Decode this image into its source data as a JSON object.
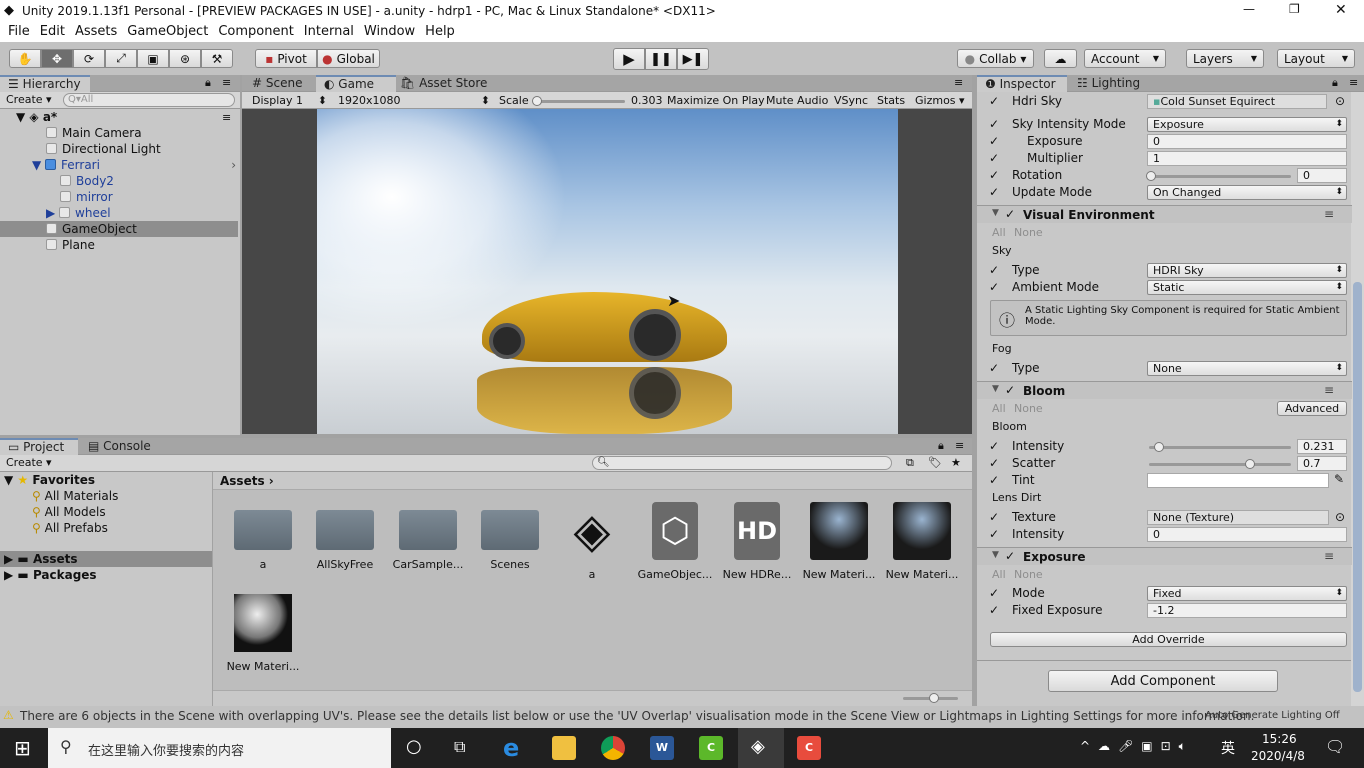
{
  "window": {
    "title": "Unity 2019.1.13f1 Personal - [PREVIEW PACKAGES IN USE] - a.unity - hdrp1 - PC, Mac & Linux Standalone* <DX11>",
    "minimize": "—",
    "maximize": "❐",
    "close": "✕"
  },
  "menu": [
    "File",
    "Edit",
    "Assets",
    "GameObject",
    "Component",
    "Internal",
    "Window",
    "Help"
  ],
  "toolbar": {
    "tools": [
      "hand-icon",
      "move-icon",
      "rotate-icon",
      "scale-icon",
      "rect-icon",
      "transform-icon",
      "custom-tool-icon"
    ],
    "pivot": "Pivot",
    "global": "Global",
    "collab": "Collab ▾",
    "account": "Account",
    "layers": "Layers",
    "layout": "Layout"
  },
  "hierarchy": {
    "tab": "Hierarchy",
    "create": "Create",
    "search_placeholder": "All",
    "scene": "a*",
    "items": [
      {
        "label": "Main Camera"
      },
      {
        "label": "Directional Light"
      },
      {
        "label": "Ferrari"
      },
      {
        "label": "Body2"
      },
      {
        "label": "mirror"
      },
      {
        "label": "wheel"
      },
      {
        "label": "GameObject"
      },
      {
        "label": "Plane"
      }
    ]
  },
  "scene": {
    "tabs": [
      "Scene",
      "Game",
      "Asset Store"
    ],
    "display": "Display 1",
    "resolution": "1920x1080",
    "scale_label": "Scale",
    "scale_value": "0.303",
    "maximize": "Maximize On Play",
    "mute": "Mute Audio",
    "vsync": "VSync",
    "stats": "Stats",
    "gizmos": "Gizmos"
  },
  "project": {
    "tabs": [
      "Project",
      "Console"
    ],
    "create": "Create",
    "favorites": "Favorites",
    "fav_items": [
      "All Materials",
      "All Models",
      "All Prefabs"
    ],
    "roots": [
      "Assets",
      "Packages"
    ],
    "breadcrumb": "Assets",
    "assets": [
      "a",
      "AllSkyFree",
      "CarSample...",
      "Scenes",
      "a",
      "GameObjec...",
      "New HDRe...",
      "New Materi...",
      "New Materi...",
      "New Materi..."
    ],
    "hd": "HD"
  },
  "inspector": {
    "tabs": [
      "Inspector",
      "Lighting"
    ],
    "hdri_sky": "Hdri Sky",
    "hdri_value": "Cold Sunset Equirect",
    "sky_intensity_mode": "Sky Intensity Mode",
    "sky_intensity_value": "Exposure",
    "exposure": "Exposure",
    "exposure_value": "0",
    "multiplier": "Multiplier",
    "multiplier_value": "1",
    "rotation": "Rotation",
    "rotation_value": "0",
    "update_mode": "Update Mode",
    "update_value": "On Changed",
    "visual_env": "Visual Environment",
    "all": "All",
    "none": "None",
    "sky": "Sky",
    "type": "Type",
    "type_value": "HDRI Sky",
    "ambient_mode": "Ambient Mode",
    "ambient_value": "Static",
    "help": "A Static Lighting Sky Component is required for Static Ambient Mode.",
    "fog": "Fog",
    "fog_type_value": "None",
    "bloom": "Bloom",
    "advanced": "Advanced",
    "bloom_sub": "Bloom",
    "intensity": "Intensity",
    "intensity_value": "0.231",
    "scatter": "Scatter",
    "scatter_value": "0.7",
    "tint": "Tint",
    "lens_dirt": "Lens Dirt",
    "texture": "Texture",
    "texture_value": "None (Texture)",
    "dirt_intensity_value": "0",
    "exposure_sec": "Exposure",
    "mode": "Mode",
    "mode_value": "Fixed",
    "fixed_exposure": "Fixed Exposure",
    "fixed_exposure_value": "-1.2",
    "add_override": "Add Override",
    "add_component": "Add Component",
    "intensity_fraction": 0.231,
    "scatter_fraction": 0.7
  },
  "status": {
    "message": "There are 6 objects in the Scene with overlapping UV's. Please see the details list below or use the 'UV Overlap' visualisation mode in the Scene View or Lightmaps in Lighting Settings for more information.",
    "lighting": "Auto Generate Lighting Off"
  },
  "taskbar": {
    "search_placeholder": "在这里输入你要搜索的内容",
    "ime": "英",
    "time": "15:26",
    "date": "2020/4/8"
  },
  "colors": {
    "accent": "#6d8bb3",
    "selection": "#8e8e8e",
    "car": "#d9a520"
  }
}
